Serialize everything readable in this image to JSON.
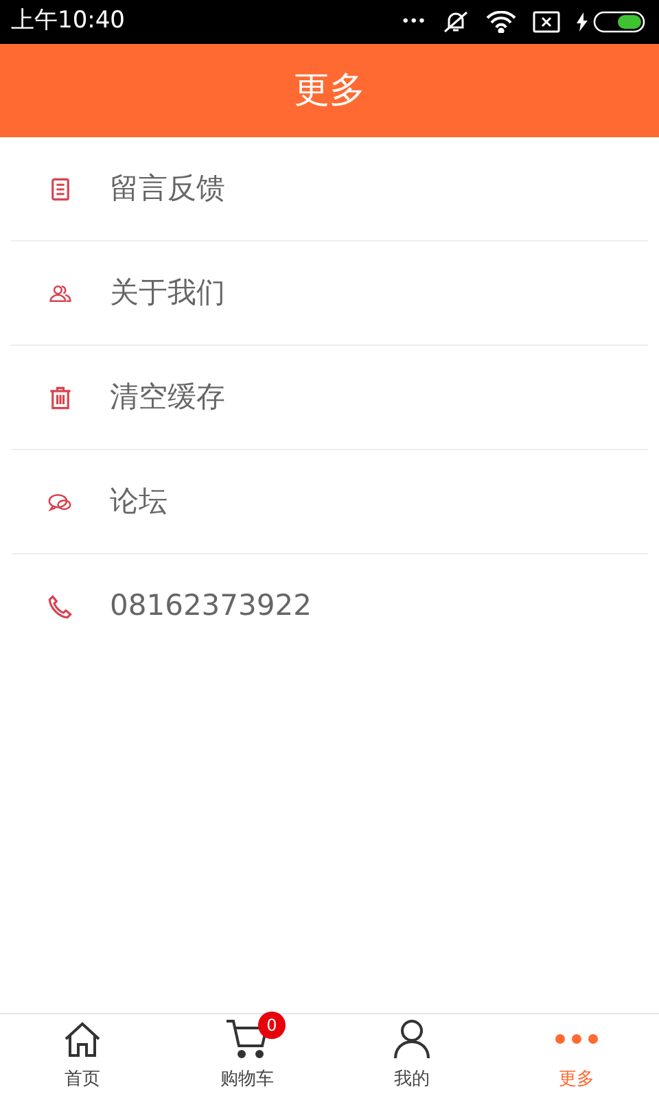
{
  "status_bar": {
    "time": "上午10:40",
    "dots": "•••"
  },
  "header": {
    "title": "更多"
  },
  "menu": [
    {
      "label": "留言反馈"
    },
    {
      "label": "关于我们"
    },
    {
      "label": "清空缓存"
    },
    {
      "label": "论坛"
    },
    {
      "label": "08162373922"
    }
  ],
  "tab_bar": [
    {
      "label": "首页",
      "selected": false
    },
    {
      "label": "购物车",
      "selected": false,
      "badge": "0"
    },
    {
      "label": "我的",
      "selected": false
    },
    {
      "label": "更多",
      "selected": true
    }
  ]
}
